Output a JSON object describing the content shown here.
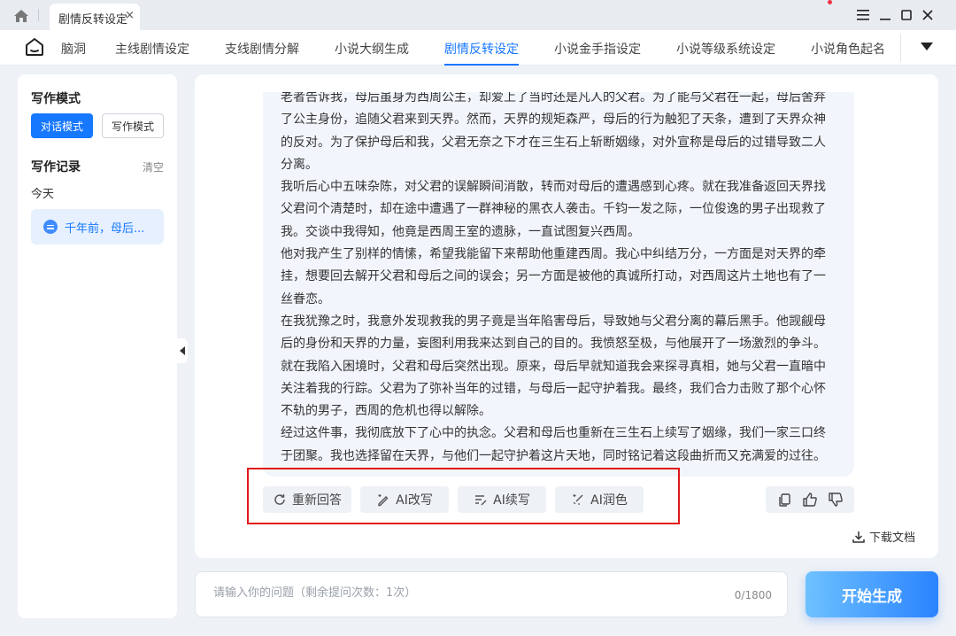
{
  "titlebar": {
    "tab_title": "剧情反转设定",
    "tab_close": "×"
  },
  "nav": {
    "items": [
      "脑洞",
      "主线剧情设定",
      "支线剧情分解",
      "小说大纲生成",
      "剧情反转设定",
      "小说金手指设定",
      "小说等级系统设定",
      "小说角色起名"
    ],
    "active_index": 4
  },
  "sidebar": {
    "mode_title": "写作模式",
    "mode_chat": "对话模式",
    "mode_write": "写作模式",
    "history_title": "写作记录",
    "clear": "清空",
    "today": "今天",
    "history_item": "千年前，母后..."
  },
  "answer": {
    "paragraphs": [
      "老者告诉我，母后虽身为西周公主，却爱上了当时还是凡人的父君。为了能与父君在一起，母后舍弃了公主身份，追随父君来到天界。然而，天界的规矩森严，母后的行为触犯了天条，遭到了天界众神的反对。为了保护母后和我，父君无奈之下才在三生石上斩断姻缘，对外宣称是母后的过错导致二人分离。",
      "我听后心中五味杂陈，对父君的误解瞬间消散，转而对母后的遭遇感到心疼。就在我准备返回天界找父君问个清楚时，却在途中遭遇了一群神秘的黑衣人袭击。千钧一发之际，一位俊逸的男子出现救了我。交谈中我得知，他竟是西周王室的遗脉，一直试图复兴西周。",
      "他对我产生了别样的情愫，希望我能留下来帮助他重建西周。我心中纠结万分，一方面是对天界的牵挂，想要回去解开父君和母后之间的误会；另一方面是被他的真诚所打动，对西周这片土地也有了一丝眷恋。",
      "在我犹豫之时，我意外发现救我的男子竟是当年陷害母后，导致她与父君分离的幕后黑手。他觊觎母后的身份和天界的力量，妄图利用我来达到自己的目的。我愤怒至极，与他展开了一场激烈的争斗。就在我陷入困境时，父君和母后突然出现。原来，母后早就知道我会来探寻真相，她与父君一直暗中关注着我的行踪。父君为了弥补当年的过错，与母后一起守护着我。最终，我们合力击败了那个心怀不轨的男子，西周的危机也得以解除。",
      "经过这件事，我彻底放下了心中的执念。父君和母后也重新在三生石上续写了姻缘，我们一家三口终于团聚。我也选择留在天界，与他们一起守护着这片天地，同时铭记着这段曲折而又充满爱的过往。"
    ]
  },
  "actions": {
    "regenerate": "重新回答",
    "rewrite": "AI改写",
    "continue": "AI续写",
    "polish": "AI润色",
    "download": "下载文档"
  },
  "input": {
    "placeholder": "请输入你的问题（剩余提问次数：1次）",
    "counter": "0/1800",
    "submit": "开始生成"
  },
  "colors": {
    "accent": "#1677ff",
    "highlight_box": "#e0181b"
  }
}
